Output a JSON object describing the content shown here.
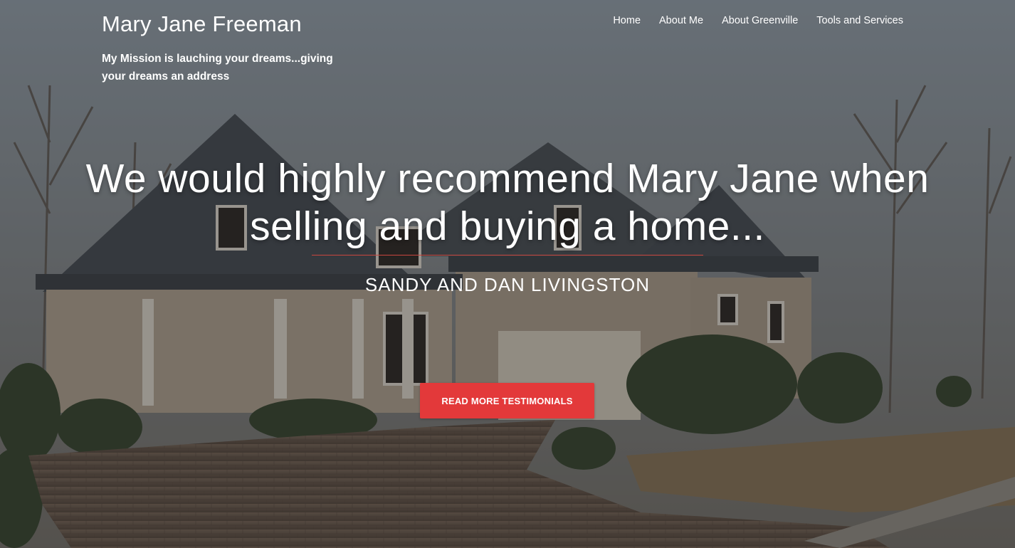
{
  "header": {
    "site_title": "Mary Jane Freeman",
    "tagline": "My Mission is lauching your dreams...giving your dreams an address"
  },
  "nav": {
    "items": [
      {
        "label": "Home"
      },
      {
        "label": "About Me"
      },
      {
        "label": "About Greenville"
      },
      {
        "label": "Tools and Services"
      }
    ]
  },
  "hero": {
    "background_image": "photo-of-suburban-house-with-brick-driveway",
    "quote": "We would highly recommend Mary Jane when selling and buying a home...",
    "author": "SANDY AND DAN LIVINGSTON",
    "cta_label": "READ MORE TESTIMONIALS"
  },
  "colors": {
    "accent": "#e3393a",
    "divider": "#c9463e",
    "text": "#ffffff"
  }
}
